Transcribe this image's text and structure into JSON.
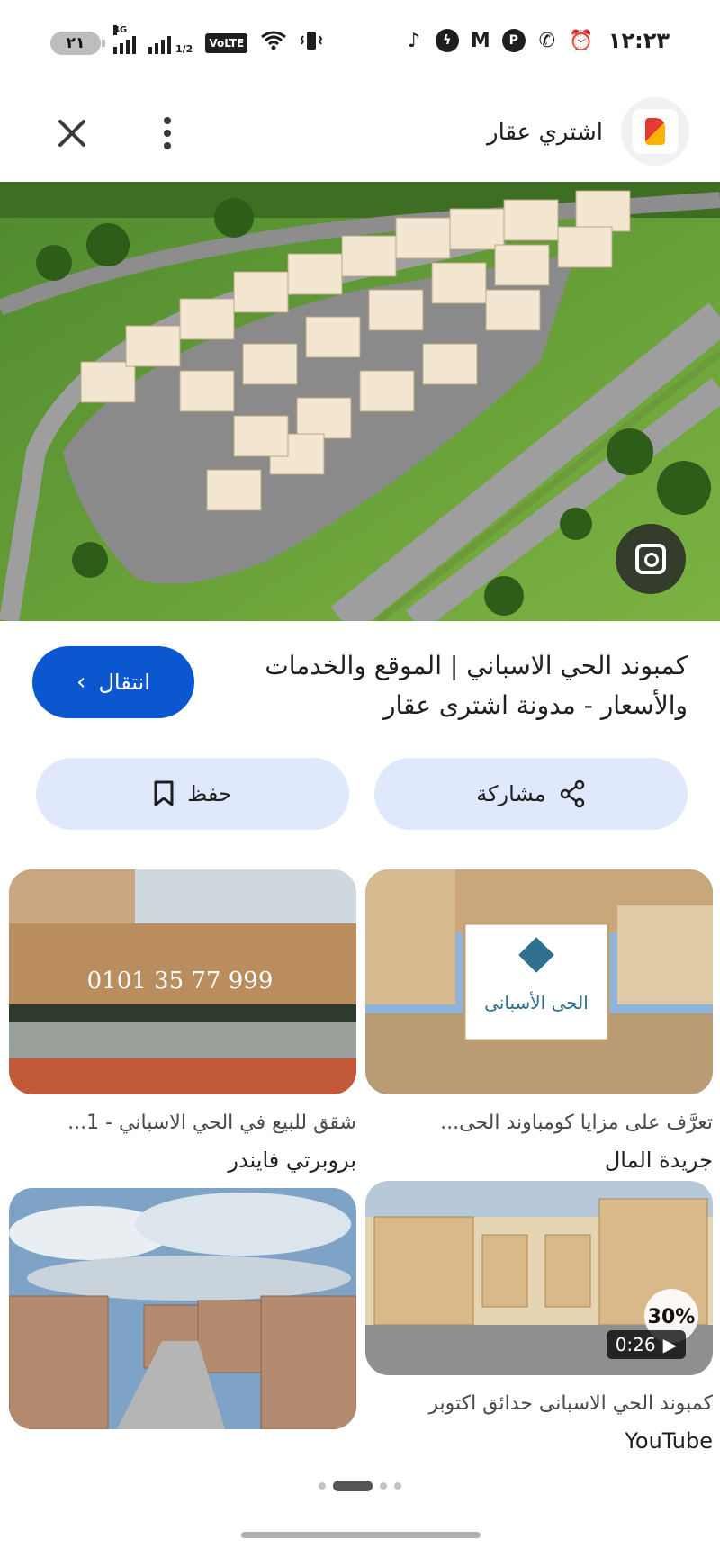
{
  "status_bar": {
    "battery": "٢١",
    "network_label": "4G",
    "signal_fraction": "1/2",
    "volte": "VoLTE",
    "clock": "١٢:٢٣",
    "icons": [
      "tiktok-icon",
      "messenger-icon",
      "gmail-icon",
      "pinterest-icon",
      "whatsapp-icon",
      "alarm-icon"
    ]
  },
  "header": {
    "site_name": "اشتري عقار"
  },
  "result": {
    "title": "كمبوند الحي الاسباني | الموقع والخدمات والأسعار - مدونة اشترى عقار",
    "visit_label": "انتقال"
  },
  "actions": {
    "share_label": "مشاركة",
    "save_label": "حفظ"
  },
  "related": [
    {
      "caption": "تعرَّف على مزايا كومباوند الحى...",
      "source": "جريدة المال",
      "overlay": "الحى الأسبانى"
    },
    {
      "caption": "شقق للبيع في الحي الاسباني - 1...",
      "source": "بروبرتي فايندر",
      "overlay": "0101 35 77 999"
    },
    {
      "caption": "كمبوند الحي الاسبانى حدائق اكتوبر",
      "source": "YouTube",
      "duration": "0:26",
      "overlay": "30%"
    },
    {
      "caption": "",
      "source": ""
    }
  ],
  "colors": {
    "accent": "#0b57d0",
    "pill": "#dfe9fb"
  }
}
